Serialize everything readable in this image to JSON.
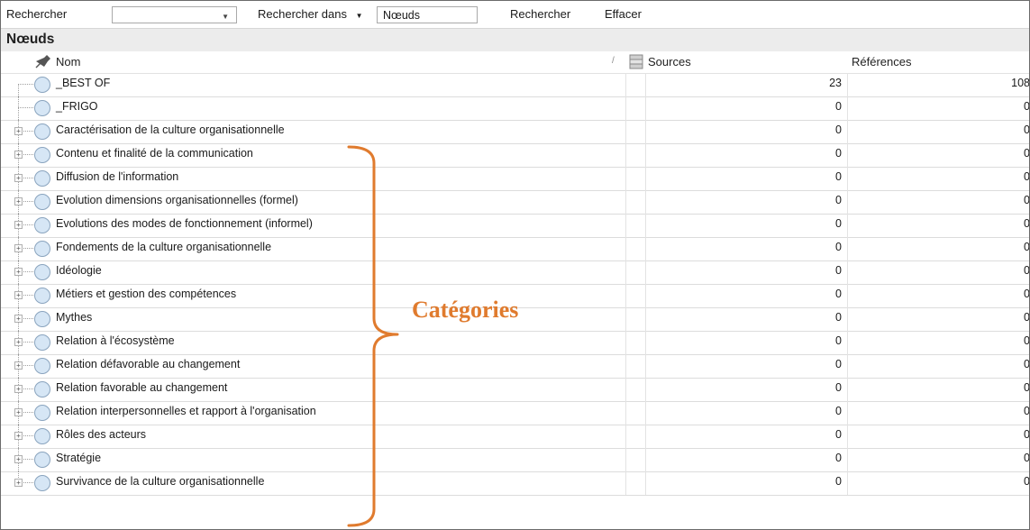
{
  "toolbar": {
    "search_label": "Rechercher",
    "search_value": "",
    "search_in_label": "Rechercher dans",
    "scope_value": "Nœuds",
    "search_button": "Rechercher",
    "clear_button": "Effacer"
  },
  "panel": {
    "title": "Nœuds",
    "columns": {
      "name": "Nom",
      "sources": "Sources",
      "references": "Références"
    }
  },
  "rows": [
    {
      "name": "_BEST OF",
      "sources": "23",
      "references": "108"
    },
    {
      "name": "_FRIGO",
      "sources": "0",
      "references": "0"
    },
    {
      "name": "Caractérisation de la culture organisationnelle",
      "sources": "0",
      "references": "0"
    },
    {
      "name": "Contenu et finalité de la communication",
      "sources": "0",
      "references": "0"
    },
    {
      "name": "Diffusion de l'information",
      "sources": "0",
      "references": "0"
    },
    {
      "name": "Evolution dimensions organisationnelles (formel)",
      "sources": "0",
      "references": "0"
    },
    {
      "name": "Evolutions des modes de fonctionnement (informel)",
      "sources": "0",
      "references": "0"
    },
    {
      "name": "Fondements de la culture organisationnelle",
      "sources": "0",
      "references": "0"
    },
    {
      "name": "Idéologie",
      "sources": "0",
      "references": "0"
    },
    {
      "name": "Métiers et gestion des compétences",
      "sources": "0",
      "references": "0"
    },
    {
      "name": "Mythes",
      "sources": "0",
      "references": "0"
    },
    {
      "name": "Relation à l'écosystème",
      "sources": "0",
      "references": "0"
    },
    {
      "name": "Relation défavorable au changement",
      "sources": "0",
      "references": "0"
    },
    {
      "name": "Relation favorable au changement",
      "sources": "0",
      "references": "0"
    },
    {
      "name": "Relation interpersonnelles et rapport à l'organisation",
      "sources": "0",
      "references": "0"
    },
    {
      "name": "Rôles des acteurs",
      "sources": "0",
      "references": "0"
    },
    {
      "name": "Stratégie",
      "sources": "0",
      "references": "0"
    },
    {
      "name": "Survivance de la culture organisationnelle",
      "sources": "0",
      "references": "0"
    }
  ],
  "annotation": {
    "label": "Catégories",
    "color": "#e07b2e"
  },
  "icons": {
    "pin": "pin-icon",
    "sources_column": "documents-icon",
    "node": "node-circle-icon",
    "expand": "plus-expander-icon"
  }
}
